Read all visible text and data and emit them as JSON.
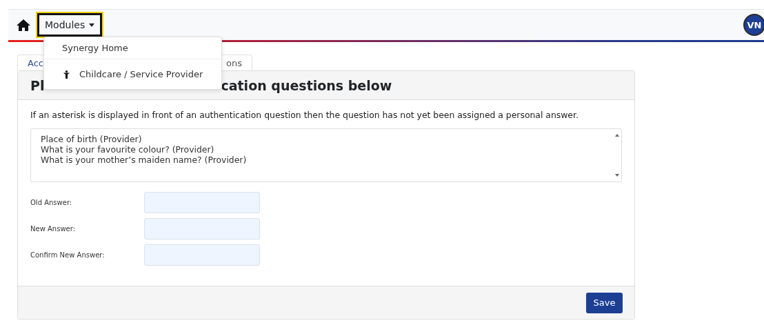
{
  "navbar": {
    "menu_button": "Modules",
    "avatar": "VN"
  },
  "modules_menu": {
    "expanded": true,
    "items": [
      {
        "label": "Synergy Home",
        "kind": "plain"
      },
      {
        "label": "Childcare / Service Provider",
        "kind": "icon"
      }
    ]
  },
  "tab": {
    "label_start": "Acc",
    "label_end": "ons"
  },
  "card": {
    "title_start": "Pl",
    "title_end": "cation questions below",
    "note": "If an asterisk is displayed in front of an authentication question then the question has not yet been assigned a personal answer.",
    "questions": [
      "Place of birth (Provider)",
      "What is your favourite colour? (Provider)",
      "What is your mother’s maiden name? (Provider)"
    ],
    "fields": [
      {
        "label": "Old Answer:"
      },
      {
        "label": "New Answer:"
      },
      {
        "label": "Confirm New Answer:"
      }
    ],
    "save_button": "Save"
  }
}
